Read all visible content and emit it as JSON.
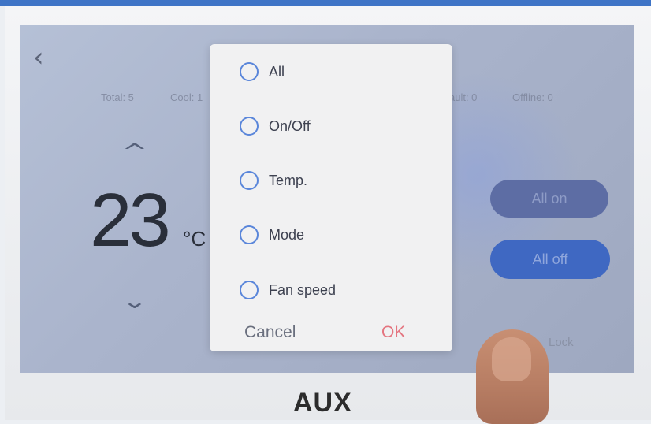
{
  "device": {
    "brand": "AUX",
    "accent_color": "#3e74c6"
  },
  "screen": {
    "back_icon": "chevron-left-icon",
    "stats": {
      "total": "Total: 5",
      "cool": "Cool: 1",
      "fault": "ault: 0",
      "offline": "Offline: 0"
    },
    "temperature": {
      "value": "23",
      "unit": "°C",
      "up_icon": "chevron-up-icon",
      "down_icon": "chevron-down-icon"
    },
    "buttons": {
      "all_on": "All on",
      "all_off": "All off",
      "lock": "Lock"
    }
  },
  "dialog": {
    "options": [
      {
        "label": "All",
        "selected": false
      },
      {
        "label": "On/Off",
        "selected": false
      },
      {
        "label": "Temp.",
        "selected": false
      },
      {
        "label": "Mode",
        "selected": false
      },
      {
        "label": "Fan speed",
        "selected": false
      }
    ],
    "cancel_label": "Cancel",
    "ok_label": "OK",
    "ok_color": "#e47580",
    "radio_color": "#5a86da"
  }
}
